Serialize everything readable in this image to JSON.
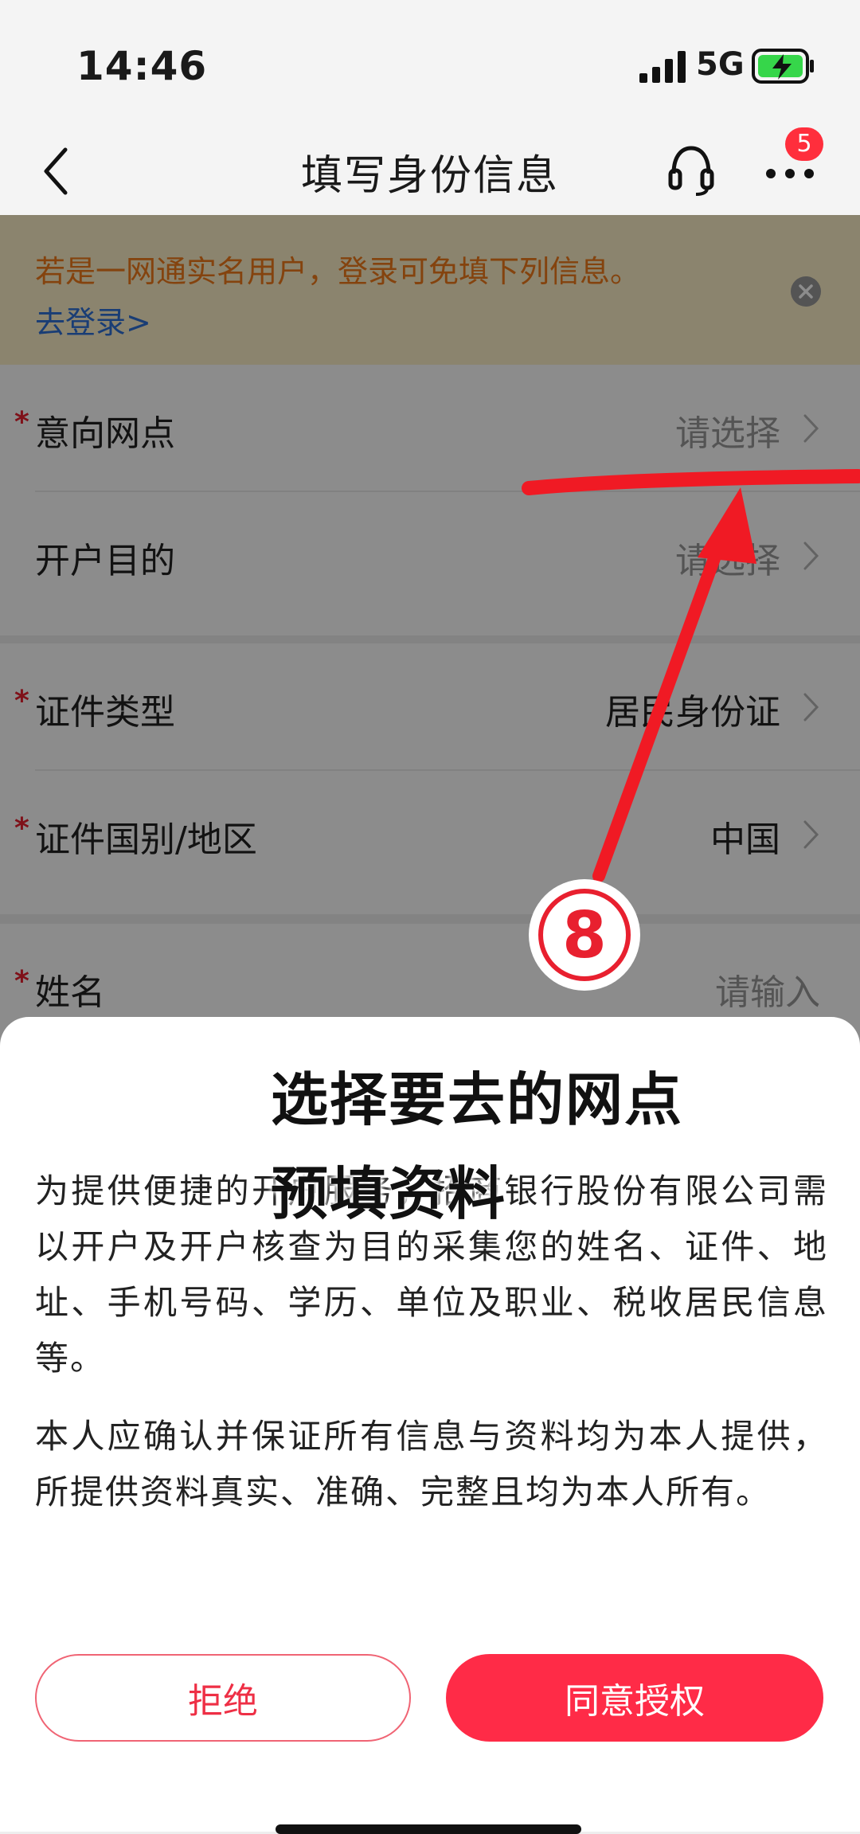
{
  "status_bar": {
    "time": "14:46",
    "network": "5G",
    "icons": [
      "signal-icon",
      "battery-charging-icon"
    ]
  },
  "nav": {
    "title": "填写身份信息",
    "badge_count": "5",
    "icons": [
      "back-icon",
      "headset-icon",
      "more-icon"
    ]
  },
  "login_banner": {
    "text": "若是一网通实名用户，登录可免填下列信息。",
    "link": "去登录>"
  },
  "form": {
    "rows": [
      {
        "label": "意向网点",
        "value": "请选择",
        "required": true
      },
      {
        "label": "开户目的",
        "value": "请选择",
        "required": false
      },
      {
        "label": "证件类型",
        "value": "居民身份证",
        "required": true
      },
      {
        "label": "证件国别/地区",
        "value": "中国",
        "required": true
      },
      {
        "label": "姓名",
        "value": "请输入",
        "required": true
      }
    ]
  },
  "consent": {
    "paragraph1": "为提供便捷的开户服务，招商银行股份有限公司需以开户及开户核查为目的采集您的姓名、证件、地址、手机号码、学历、单位及职业、税收居民信息等。",
    "paragraph2": "本人应确认并保证所有信息与资料均为本人提供，所提供资料真实、准确、完整且均为本人所有。",
    "reject_label": "拒绝",
    "agree_label": "同意授权"
  },
  "annotation": {
    "heading_line1": "选择要去的网点",
    "heading_line2": "预填资料",
    "step_number": "8",
    "color": "#e8202f"
  },
  "colors": {
    "accent": "#ff2b47",
    "banner_text": "#f07a1a",
    "link": "#2f6fd6",
    "required": "#e8202f"
  }
}
